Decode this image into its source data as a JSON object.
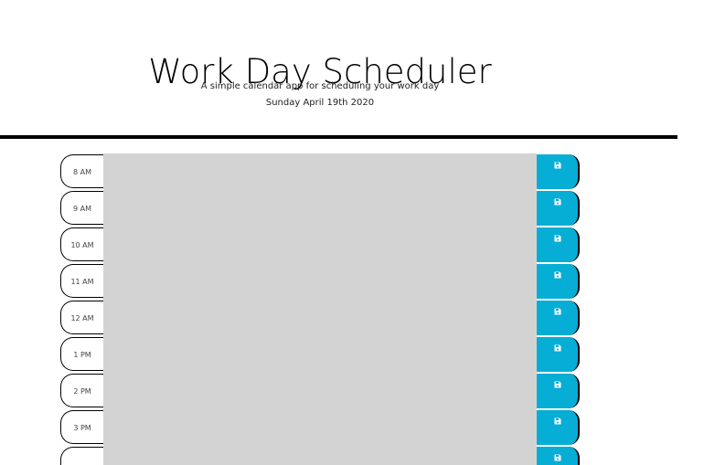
{
  "header": {
    "title": "Work Day Scheduler",
    "subtitle": "A simple calendar app for scheduling your work day",
    "current_day": "Sunday April 19th 2020"
  },
  "colors": {
    "save_button": "#06aed5",
    "textarea_past": "#d3d3d3",
    "divider": "#000000"
  },
  "time_blocks": [
    {
      "hour": "8 AM",
      "text": "",
      "save_icon": "floppy-disk-icon"
    },
    {
      "hour": "9 AM",
      "text": "",
      "save_icon": "floppy-disk-icon"
    },
    {
      "hour": "10 AM",
      "text": "",
      "save_icon": "floppy-disk-icon"
    },
    {
      "hour": "11 AM",
      "text": "",
      "save_icon": "floppy-disk-icon"
    },
    {
      "hour": "12 AM",
      "text": "",
      "save_icon": "floppy-disk-icon"
    },
    {
      "hour": "1 PM",
      "text": "",
      "save_icon": "floppy-disk-icon"
    },
    {
      "hour": "2 PM",
      "text": "",
      "save_icon": "floppy-disk-icon"
    },
    {
      "hour": "3 PM",
      "text": "",
      "save_icon": "floppy-disk-icon"
    },
    {
      "hour": "",
      "text": "",
      "save_icon": "floppy-disk-icon"
    }
  ]
}
